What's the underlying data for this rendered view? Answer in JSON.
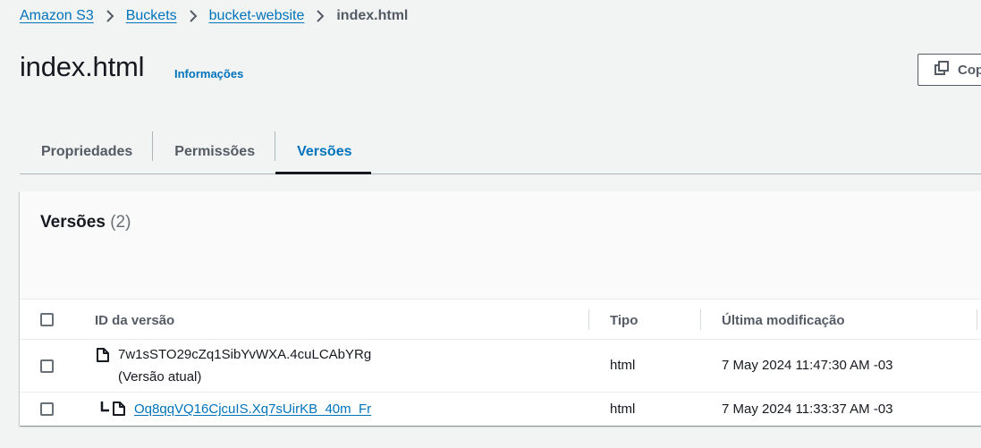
{
  "breadcrumb": {
    "items": [
      "Amazon S3",
      "Buckets",
      "bucket-website"
    ],
    "current": "index.html"
  },
  "header": {
    "title": "index.html",
    "info_link": "Informações",
    "copy_button": "Cop"
  },
  "tabs": [
    {
      "label": "Propriedades",
      "active": false
    },
    {
      "label": "Permissões",
      "active": false
    },
    {
      "label": "Versões",
      "active": true
    }
  ],
  "versions_panel": {
    "title": "Versões",
    "count": "(2)",
    "columns": [
      "ID da versão",
      "Tipo",
      "Última modificação"
    ],
    "rows": [
      {
        "version_id": "7w1sSTO29cZq1SibYvWXA.4cuLCAbYRg",
        "current_label": "(Versão atual)",
        "type": "html",
        "last_modified": "7 May 2024 11:47:30 AM -03",
        "icon": "file-icon"
      },
      {
        "version_id": "Oq8qqVQ16CjcuIS.Xq7sUirKB_40m_Fr",
        "type": "html",
        "last_modified": "7 May 2024 11:33:37 AM -03",
        "icon": "file-icon"
      }
    ]
  },
  "colors": {
    "link": "#0073bb",
    "background": "#f2f3f3",
    "text": "#16191f",
    "muted": "#545b64"
  }
}
